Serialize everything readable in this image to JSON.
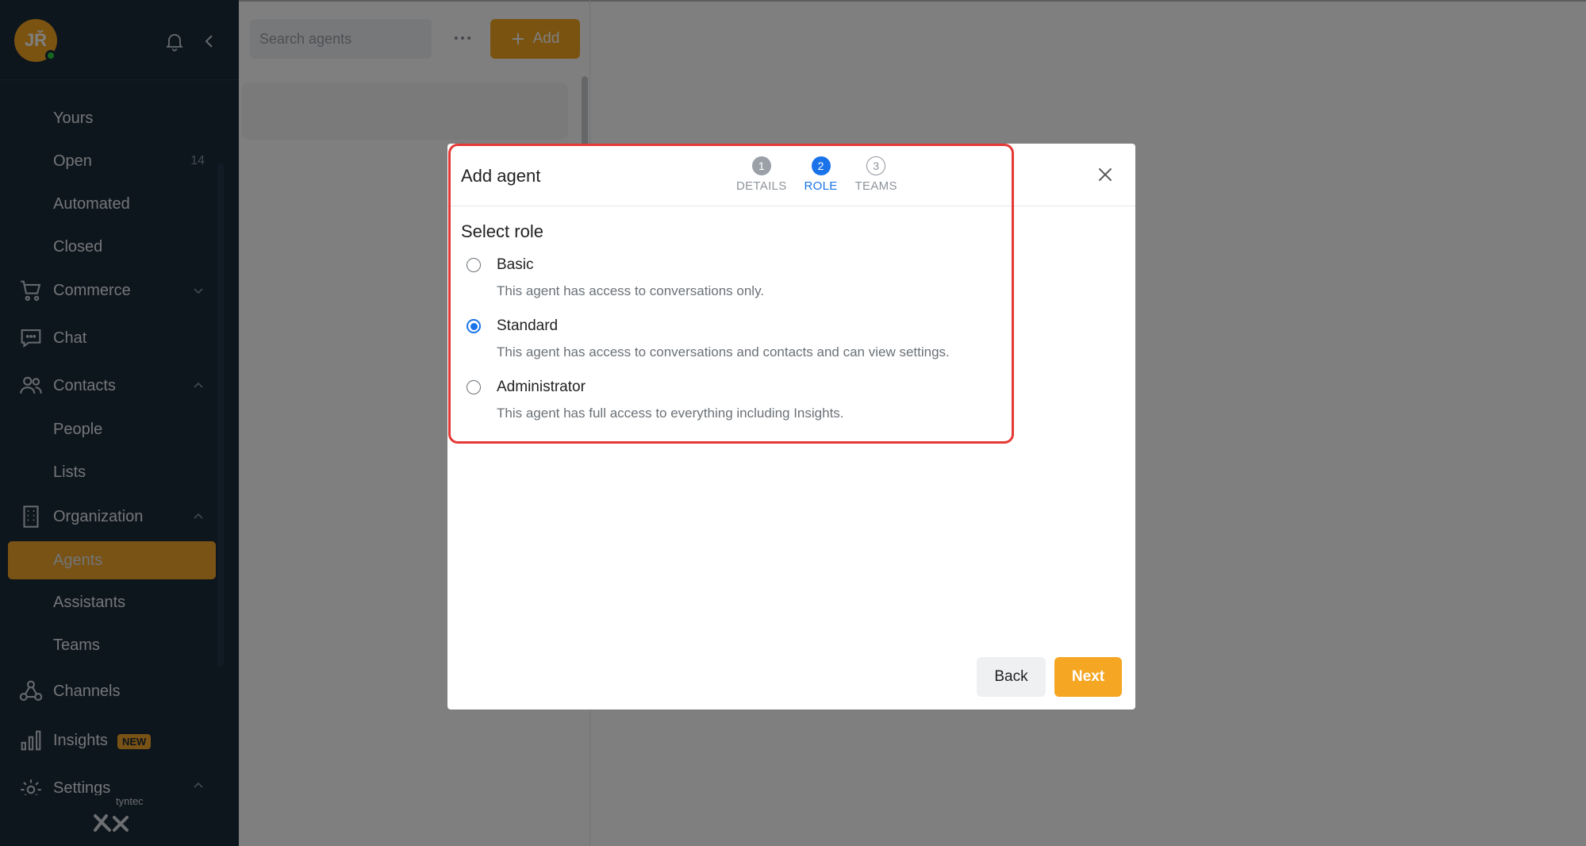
{
  "sidebar": {
    "avatar_initials": "JŘ",
    "items": [
      {
        "label": "Yours",
        "count": ""
      },
      {
        "label": "Open",
        "count": "14"
      },
      {
        "label": "Automated",
        "count": ""
      },
      {
        "label": "Closed",
        "count": ""
      },
      {
        "label": "Commerce",
        "icon": "cart-icon"
      },
      {
        "label": "Chat",
        "icon": "chat-icon"
      },
      {
        "label": "Contacts",
        "icon": "contacts-icon"
      },
      {
        "label": "People"
      },
      {
        "label": "Lists"
      },
      {
        "label": "Organization",
        "icon": "building-icon"
      },
      {
        "label": "Agents"
      },
      {
        "label": "Assistants"
      },
      {
        "label": "Teams"
      },
      {
        "label": "Channels",
        "icon": "channels-icon"
      },
      {
        "label": "Insights",
        "icon": "insights-icon",
        "badge": "NEW"
      },
      {
        "label": "Settings",
        "icon": "settings-icon"
      }
    ],
    "logo_text": "tyntec"
  },
  "toolbar": {
    "search_placeholder": "Search agents",
    "add_label": "Add"
  },
  "modal": {
    "title": "Add agent",
    "steps": [
      {
        "number": "1",
        "label": "DETAILS"
      },
      {
        "number": "2",
        "label": "ROLE"
      },
      {
        "number": "3",
        "label": "TEAMS"
      }
    ],
    "section_title": "Select role",
    "roles": [
      {
        "name": "Basic",
        "description": "This agent has access to conversations only."
      },
      {
        "name": "Standard",
        "description": "This agent has access to conversations and contacts and can view settings."
      },
      {
        "name": "Administrator",
        "description": "This agent has full access to everything including Insights."
      }
    ],
    "selected_role": "Standard",
    "back_label": "Back",
    "next_label": "Next"
  },
  "colors": {
    "accent": "#f5a623",
    "primary": "#1a73e8",
    "sidebar_bg": "#1b2b3b",
    "highlight": "#e53935"
  }
}
